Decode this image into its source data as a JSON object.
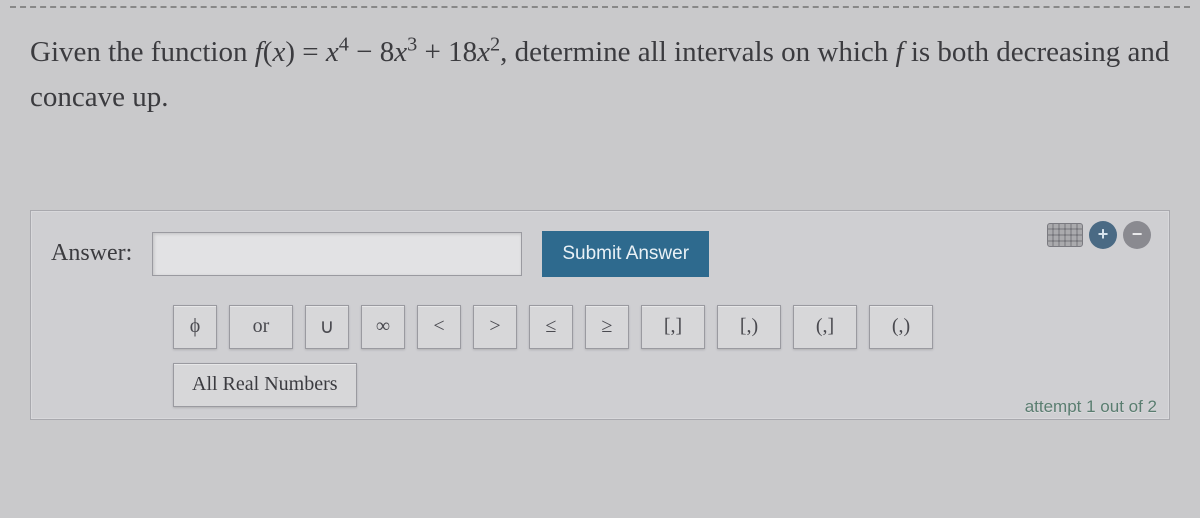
{
  "question": {
    "prefix": "Given the function ",
    "func_lhs_f": "f",
    "func_lhs_open": "(",
    "func_lhs_var": "x",
    "func_lhs_close": ") = ",
    "rhs_x1": "x",
    "rhs_sup4": "4",
    "rhs_minus": " − 8",
    "rhs_x2": "x",
    "rhs_sup3": "3",
    "rhs_plus": " + 18",
    "rhs_x3": "x",
    "rhs_sup2": "2",
    "tail1": ", determine all intervals on which ",
    "tail_f": "f",
    "tail2": " is both decreasing and concave up."
  },
  "answer_label": "Answer:",
  "answer_value": "",
  "answer_placeholder": "",
  "submit_label": "Submit Answer",
  "symbols": {
    "phi": "ϕ",
    "or": "or",
    "union": "∪",
    "infty": "∞",
    "lt": "<",
    "gt": ">",
    "le": "≤",
    "ge": "≥",
    "closed_closed": "[,]",
    "closed_open": "[,)",
    "open_closed": "(,]",
    "open_open": "(,)"
  },
  "all_real_label": "All Real Numbers",
  "controls": {
    "plus": "+",
    "minus": "−"
  },
  "attempt_text": "attempt 1 out of 2"
}
